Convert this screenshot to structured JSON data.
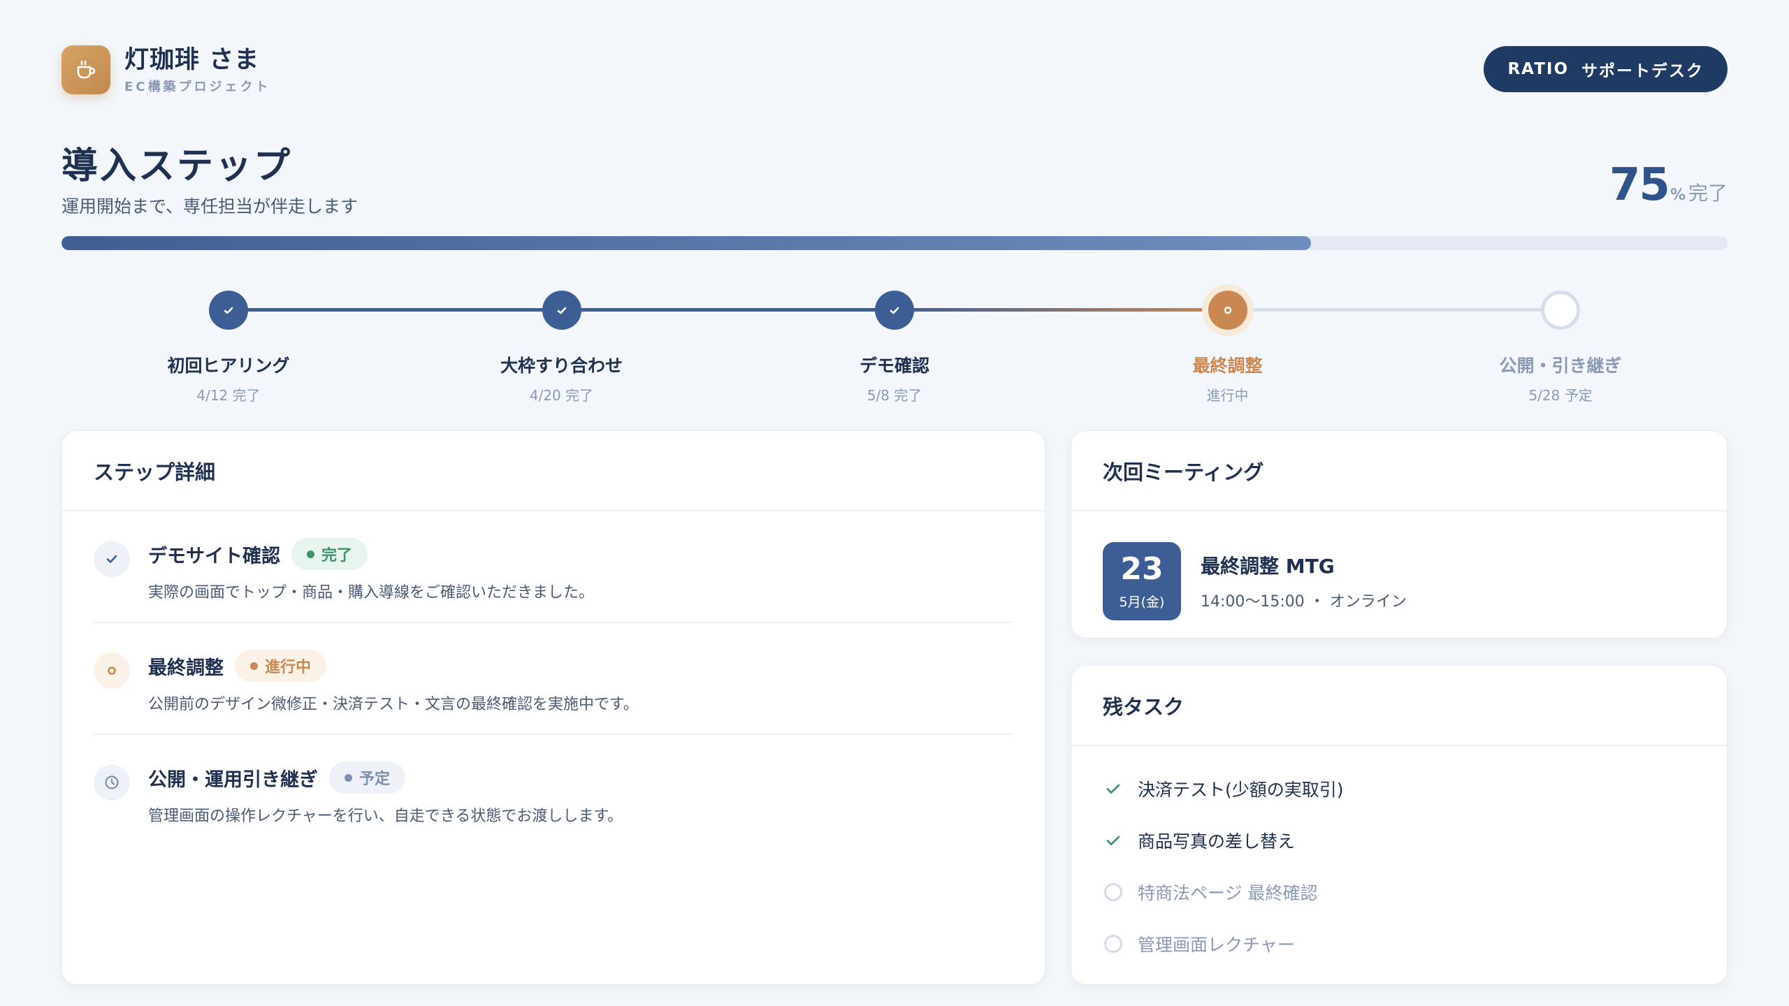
{
  "client": {
    "name": "灯珈琲 さま",
    "project": "EC構築プロジェクト",
    "logo_icon": "coffee-cup-icon"
  },
  "support": {
    "brand": "RATIO",
    "label": "サポートデスク"
  },
  "page": {
    "title": "導入ステップ",
    "subtitle": "運用開始まで、専任担当が伴走します"
  },
  "progress": {
    "value": "75",
    "unit": "%",
    "label": "完了",
    "fraction": 0.75
  },
  "steps": [
    {
      "label": "初回ヒアリング",
      "date": "4/12 完了",
      "status": "done"
    },
    {
      "label": "大枠すり合わせ",
      "date": "4/20 完了",
      "status": "done"
    },
    {
      "label": "デモ確認",
      "date": "5/8 完了",
      "status": "done"
    },
    {
      "label": "最終調整",
      "date": "進行中",
      "status": "active"
    },
    {
      "label": "公開・引き継ぎ",
      "date": "5/28 予定",
      "status": "pending"
    }
  ],
  "details": {
    "title": "ステップ詳細",
    "items": [
      {
        "title": "デモサイト確認",
        "badge": "完了",
        "status": "done",
        "desc": "実際の画面でトップ・商品・購入導線をご確認いただきました。"
      },
      {
        "title": "最終調整",
        "badge": "進行中",
        "status": "active",
        "desc": "公開前のデザイン微修正・決済テスト・文言の最終確認を実施中です。"
      },
      {
        "title": "公開・運用引き継ぎ",
        "badge": "予定",
        "status": "pending",
        "desc": "管理画面の操作レクチャーを行い、自走できる状態でお渡しします。"
      }
    ]
  },
  "meeting": {
    "title": "次回ミーティング",
    "day": "23",
    "month": "5月(金)",
    "name": "最終調整 MTG",
    "time": "14:00〜15:00 ・ オンライン"
  },
  "tasks": {
    "title": "残タスク",
    "items": [
      {
        "label": "決済テスト(少額の実取引)",
        "done": true
      },
      {
        "label": "商品写真の差し替え",
        "done": true
      },
      {
        "label": "特商法ページ 最終確認",
        "done": false
      },
      {
        "label": "管理画面レクチャー",
        "done": false
      }
    ]
  },
  "colors": {
    "navy": "#1f3a63",
    "primary": "#3d5e95",
    "accent": "#c98851",
    "success": "#3e9466",
    "muted": "#8a9ab5"
  }
}
